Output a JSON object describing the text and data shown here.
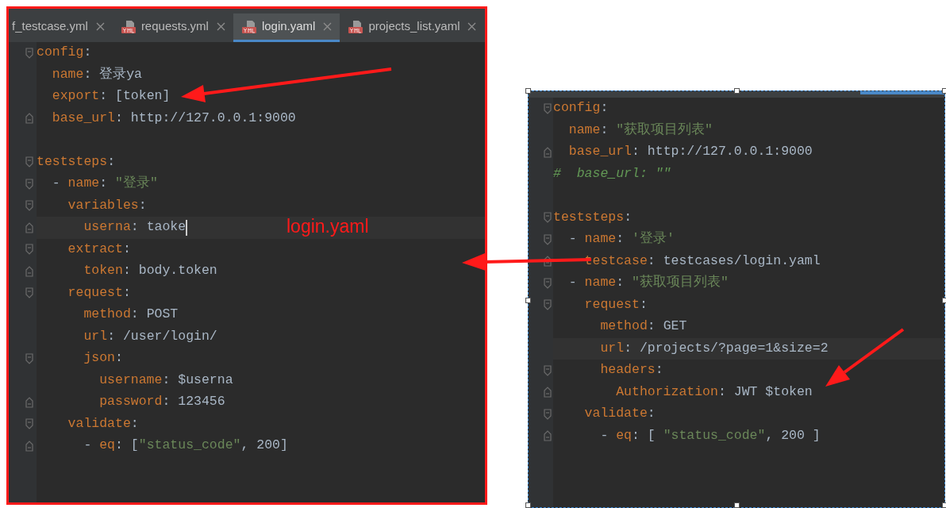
{
  "left_editor": {
    "tabs": [
      {
        "label": "f_testcase.yml",
        "selected": false,
        "has_icon": false
      },
      {
        "label": "requests.yml",
        "selected": false,
        "has_icon": true
      },
      {
        "label": "login.yaml",
        "selected": true,
        "has_icon": true
      },
      {
        "label": "projects_list.yaml",
        "selected": false,
        "has_icon": true
      }
    ],
    "lines": [
      {
        "tokens": [
          {
            "kind": "key",
            "text": "config"
          },
          {
            "kind": "punct",
            "text": ":"
          }
        ],
        "highlighted": false,
        "cursor": false,
        "children": [
          {
            "tokens": [
              {
                "kind": "key",
                "text": "name"
              },
              {
                "kind": "punct",
                "text": ": "
              },
              {
                "kind": "text",
                "text": "登录ya"
              }
            ],
            "highlighted": false,
            "cursor": false
          },
          {
            "tokens": [
              {
                "kind": "key",
                "text": "export"
              },
              {
                "kind": "punct",
                "text": ": "
              },
              {
                "kind": "text",
                "text": "[token]"
              }
            ],
            "highlighted": false,
            "cursor": false
          },
          {
            "tokens": [
              {
                "kind": "key",
                "text": "base_url"
              },
              {
                "kind": "punct",
                "text": ": "
              },
              {
                "kind": "text",
                "text": "http://127.0.0.1:9000"
              }
            ],
            "highlighted": false,
            "cursor": false
          }
        ]
      },
      {
        "kind": "blank"
      },
      {
        "tokens": [
          {
            "kind": "key",
            "text": "teststeps"
          },
          {
            "kind": "punct",
            "text": ":"
          }
        ],
        "highlighted": false,
        "cursor": false,
        "children": [
          {
            "tokens": [
              {
                "kind": "punct",
                "text": "- "
              },
              {
                "kind": "key",
                "text": "name"
              },
              {
                "kind": "punct",
                "text": ": "
              },
              {
                "kind": "string",
                "text": "\"登录\""
              }
            ],
            "highlighted": false,
            "cursor": false,
            "children": [
              {
                "tokens": [
                  {
                    "kind": "key",
                    "text": "variables"
                  },
                  {
                    "kind": "punct",
                    "text": ":"
                  }
                ],
                "highlighted": false,
                "cursor": false,
                "children": [
                  {
                    "tokens": [
                      {
                        "kind": "key",
                        "text": "userna"
                      },
                      {
                        "kind": "punct",
                        "text": ": "
                      },
                      {
                        "kind": "text",
                        "text": "taoke"
                      }
                    ],
                    "highlighted": true,
                    "cursor": true
                  }
                ]
              },
              {
                "tokens": [
                  {
                    "kind": "key",
                    "text": "extract"
                  },
                  {
                    "kind": "punct",
                    "text": ":"
                  }
                ],
                "highlighted": false,
                "cursor": false,
                "children": [
                  {
                    "tokens": [
                      {
                        "kind": "key",
                        "text": "token"
                      },
                      {
                        "kind": "punct",
                        "text": ": "
                      },
                      {
                        "kind": "text",
                        "text": "body.token"
                      }
                    ],
                    "highlighted": false,
                    "cursor": false
                  }
                ]
              },
              {
                "tokens": [
                  {
                    "kind": "key",
                    "text": "request"
                  },
                  {
                    "kind": "punct",
                    "text": ":"
                  }
                ],
                "highlighted": false,
                "cursor": false,
                "children": [
                  {
                    "tokens": [
                      {
                        "kind": "key",
                        "text": "method"
                      },
                      {
                        "kind": "punct",
                        "text": ": "
                      },
                      {
                        "kind": "text",
                        "text": "POST"
                      }
                    ],
                    "highlighted": false,
                    "cursor": false
                  },
                  {
                    "tokens": [
                      {
                        "kind": "key",
                        "text": "url"
                      },
                      {
                        "kind": "punct",
                        "text": ": "
                      },
                      {
                        "kind": "text",
                        "text": "/user/login/"
                      }
                    ],
                    "highlighted": false,
                    "cursor": false
                  },
                  {
                    "tokens": [
                      {
                        "kind": "key",
                        "text": "json"
                      },
                      {
                        "kind": "punct",
                        "text": ":"
                      }
                    ],
                    "highlighted": false,
                    "cursor": false,
                    "children": [
                      {
                        "tokens": [
                          {
                            "kind": "key",
                            "text": "username"
                          },
                          {
                            "kind": "punct",
                            "text": ": "
                          },
                          {
                            "kind": "text",
                            "text": "$userna"
                          }
                        ],
                        "highlighted": false,
                        "cursor": false
                      },
                      {
                        "tokens": [
                          {
                            "kind": "key",
                            "text": "password"
                          },
                          {
                            "kind": "punct",
                            "text": ": "
                          },
                          {
                            "kind": "text",
                            "text": "123456"
                          }
                        ],
                        "highlighted": false,
                        "cursor": false
                      }
                    ]
                  }
                ]
              },
              {
                "tokens": [
                  {
                    "kind": "key",
                    "text": "validate"
                  },
                  {
                    "kind": "punct",
                    "text": ":"
                  }
                ],
                "highlighted": false,
                "cursor": false,
                "children": [
                  {
                    "tokens": [
                      {
                        "kind": "punct",
                        "text": "- "
                      },
                      {
                        "kind": "key",
                        "text": "eq"
                      },
                      {
                        "kind": "punct",
                        "text": ": "
                      },
                      {
                        "kind": "text",
                        "text": "["
                      },
                      {
                        "kind": "string",
                        "text": "\"status_code\""
                      },
                      {
                        "kind": "text",
                        "text": ", 200]"
                      }
                    ],
                    "highlighted": false,
                    "cursor": false
                  }
                ]
              }
            ]
          }
        ]
      }
    ]
  },
  "annotation": {
    "label": "login.yaml"
  },
  "right_editor": {
    "lines": [
      {
        "tokens": [
          {
            "kind": "key",
            "text": "config"
          },
          {
            "kind": "punct",
            "text": ":"
          }
        ],
        "highlighted": false,
        "cursor": false,
        "children": [
          {
            "tokens": [
              {
                "kind": "key",
                "text": "name"
              },
              {
                "kind": "punct",
                "text": ": "
              },
              {
                "kind": "string",
                "text": "\"获取项目列表\""
              }
            ],
            "highlighted": false,
            "cursor": false
          },
          {
            "tokens": [
              {
                "kind": "key",
                "text": "base_url"
              },
              {
                "kind": "punct",
                "text": ": "
              },
              {
                "kind": "text",
                "text": "http://127.0.0.1:9000"
              }
            ],
            "highlighted": false,
            "cursor": false
          }
        ]
      },
      {
        "tokens": [
          {
            "kind": "comment",
            "text": "#  base_url: \"\""
          }
        ],
        "highlighted": false,
        "cursor": false
      },
      {
        "kind": "blank"
      },
      {
        "tokens": [
          {
            "kind": "key",
            "text": "teststeps"
          },
          {
            "kind": "punct",
            "text": ":"
          }
        ],
        "highlighted": false,
        "cursor": false,
        "children": [
          {
            "tokens": [
              {
                "kind": "punct",
                "text": "- "
              },
              {
                "kind": "key",
                "text": "name"
              },
              {
                "kind": "punct",
                "text": ": "
              },
              {
                "kind": "string",
                "text": "'登录'"
              }
            ],
            "highlighted": false,
            "cursor": false,
            "children": [
              {
                "tokens": [
                  {
                    "kind": "key",
                    "text": "testcase"
                  },
                  {
                    "kind": "punct",
                    "text": ": "
                  },
                  {
                    "kind": "text",
                    "text": "testcases/login.yaml"
                  }
                ],
                "highlighted": false,
                "cursor": false
              }
            ]
          },
          {
            "tokens": [
              {
                "kind": "punct",
                "text": "- "
              },
              {
                "kind": "key",
                "text": "name"
              },
              {
                "kind": "punct",
                "text": ": "
              },
              {
                "kind": "string",
                "text": "\"获取项目列表\""
              }
            ],
            "highlighted": false,
            "cursor": false,
            "children": [
              {
                "tokens": [
                  {
                    "kind": "key",
                    "text": "request"
                  },
                  {
                    "kind": "punct",
                    "text": ":"
                  }
                ],
                "highlighted": false,
                "cursor": false,
                "children": [
                  {
                    "tokens": [
                      {
                        "kind": "key",
                        "text": "method"
                      },
                      {
                        "kind": "punct",
                        "text": ": "
                      },
                      {
                        "kind": "text",
                        "text": "GET"
                      }
                    ],
                    "highlighted": false,
                    "cursor": false
                  },
                  {
                    "tokens": [
                      {
                        "kind": "key",
                        "text": "url"
                      },
                      {
                        "kind": "punct",
                        "text": ": "
                      },
                      {
                        "kind": "text",
                        "text": "/projects/?page=1&size=2"
                      }
                    ],
                    "highlighted": true,
                    "cursor": false
                  },
                  {
                    "tokens": [
                      {
                        "kind": "key",
                        "text": "headers"
                      },
                      {
                        "kind": "punct",
                        "text": ":"
                      }
                    ],
                    "highlighted": false,
                    "cursor": false,
                    "children": [
                      {
                        "tokens": [
                          {
                            "kind": "key",
                            "text": "Authorization"
                          },
                          {
                            "kind": "punct",
                            "text": ": "
                          },
                          {
                            "kind": "text",
                            "text": "JWT $token"
                          }
                        ],
                        "highlighted": false,
                        "cursor": false
                      }
                    ]
                  }
                ]
              },
              {
                "tokens": [
                  {
                    "kind": "key",
                    "text": "validate"
                  },
                  {
                    "kind": "punct",
                    "text": ":"
                  }
                ],
                "highlighted": false,
                "cursor": false,
                "children": [
                  {
                    "tokens": [
                      {
                        "kind": "punct",
                        "text": "- "
                      },
                      {
                        "kind": "key",
                        "text": "eq"
                      },
                      {
                        "kind": "punct",
                        "text": ": "
                      },
                      {
                        "kind": "text",
                        "text": "[ "
                      },
                      {
                        "kind": "string",
                        "text": "\"status_code\""
                      },
                      {
                        "kind": "text",
                        "text": ", 200 ]"
                      }
                    ],
                    "highlighted": false,
                    "cursor": false
                  }
                ]
              }
            ]
          }
        ]
      }
    ]
  }
}
